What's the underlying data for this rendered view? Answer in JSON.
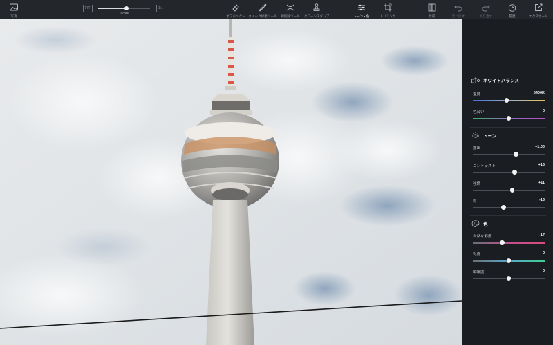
{
  "toolbar": {
    "photos_label": "写真",
    "zoom": {
      "fit_label": "FIT",
      "actual_label": "1:1",
      "value": "178%",
      "fraction": 0.55
    },
    "tools": [
      {
        "label": "オブジェクト",
        "icon": "object-eraser-icon"
      },
      {
        "label": "クイック修復ツール",
        "icon": "quick-repair-icon"
      },
      {
        "label": "線削除ツール",
        "icon": "line-removal-icon"
      },
      {
        "label": "クローンスタンプ",
        "icon": "clone-stamp-icon"
      },
      {
        "label": "トーン・色",
        "icon": "tone-sliders-icon",
        "active": true
      },
      {
        "label": "トリミング",
        "icon": "crop-icon"
      }
    ],
    "actions": [
      {
        "label": "比較",
        "icon": "compare-icon"
      },
      {
        "label": "元に戻す",
        "icon": "undo-icon"
      },
      {
        "label": "やり直す",
        "icon": "redo-icon"
      },
      {
        "label": "履歴",
        "icon": "history-icon"
      },
      {
        "label": "エクスポート",
        "icon": "export-icon"
      }
    ]
  },
  "panel": {
    "white_balance": {
      "title": "ホワイトバランス",
      "icon": "white-balance-icon",
      "sliders": [
        {
          "label": "温度",
          "value": "5400K",
          "fraction": 0.47,
          "track": "temperature"
        },
        {
          "label": "色合い",
          "value": "0",
          "fraction": 0.5,
          "track": "tint"
        }
      ]
    },
    "tone": {
      "title": "トーン",
      "icon": "sun-icon",
      "sliders": [
        {
          "label": "露出",
          "value": "+1.00",
          "fraction": 0.6,
          "track": "plain"
        },
        {
          "label": "コントラスト",
          "value": "+16",
          "fraction": 0.58,
          "track": "plain"
        },
        {
          "label": "強調",
          "value": "+11",
          "fraction": 0.55,
          "track": "plain"
        },
        {
          "label": "影",
          "value": "-13",
          "fraction": 0.43,
          "track": "plain"
        }
      ]
    },
    "color": {
      "title": "色",
      "icon": "palette-icon",
      "sliders": [
        {
          "label": "自然な彩度",
          "value": "-17",
          "fraction": 0.41,
          "track": "vibrance"
        },
        {
          "label": "彩度",
          "value": "0",
          "fraction": 0.5,
          "track": "saturation"
        },
        {
          "label": "明瞭度",
          "value": "0",
          "fraction": 0.5,
          "track": "plain"
        }
      ]
    }
  },
  "colors": {
    "toolbar_bg": "#23262b",
    "panel_bg": "#1a1d22",
    "accent_text": "#f1f2f4"
  }
}
